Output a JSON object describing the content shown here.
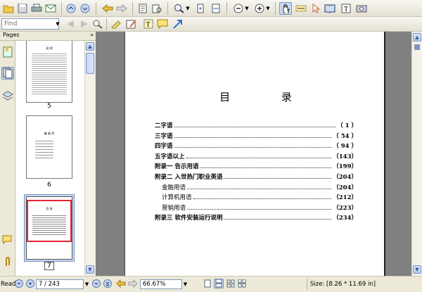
{
  "toolbar2": {
    "find_placeholder": "Find"
  },
  "sidebar": {
    "panel_title": "Pages",
    "collapse_glyph": "«"
  },
  "thumbnails": [
    {
      "label": "5",
      "title": "说  明"
    },
    {
      "label": "6",
      "title": "编 者 序"
    },
    {
      "label": "7",
      "title": "目  录",
      "selected": true
    }
  ],
  "document": {
    "title": "目 录",
    "toc": [
      {
        "title": "二字语",
        "page": "（ 1 ）"
      },
      {
        "title": "三字语",
        "page": "（ 54 ）"
      },
      {
        "title": "四字语",
        "page": "（ 94 ）"
      },
      {
        "title": "五字语以上",
        "page": "（143）"
      },
      {
        "title": "附录一  告示用语",
        "page": "（199）"
      },
      {
        "title": "附录二  入世热门职业英语",
        "page": "（204）"
      },
      {
        "title": "金融用语",
        "page": "（204）"
      },
      {
        "title": "计算机用语",
        "page": "（212）"
      },
      {
        "title": "营销用语",
        "page": "（223）"
      },
      {
        "title": "附录三  软件安装运行说明",
        "page": "（234）"
      }
    ]
  },
  "statusbar": {
    "mode_label": "Read",
    "page_indicator": "7 / 243",
    "zoom": "66.67%",
    "size_label": "Size: [8.26 * 11.69 in]"
  },
  "colors": {
    "selection_border": "#e32636",
    "scroll_blue": "#7a95c3"
  }
}
